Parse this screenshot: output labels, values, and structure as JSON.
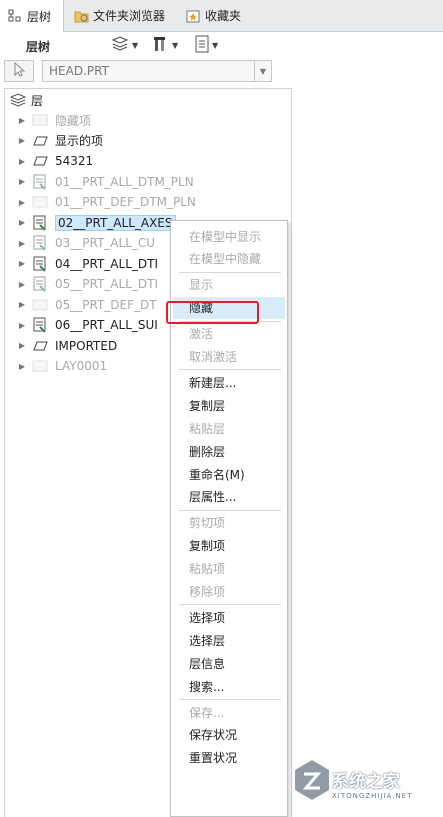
{
  "tabs": [
    {
      "label": "层树",
      "icon": "layer-tree-icon"
    },
    {
      "label": "文件夹浏览器",
      "icon": "folder-browser-icon"
    },
    {
      "label": "收藏夹",
      "icon": "favorites-icon"
    }
  ],
  "toolbar": {
    "label": "层树",
    "buttons": [
      {
        "icon": "layers-menu-icon"
      },
      {
        "icon": "tools-menu-icon"
      },
      {
        "icon": "settings-list-icon"
      }
    ]
  },
  "selector": {
    "model": "HEAD.PRT"
  },
  "tree": {
    "root_label": "层",
    "rows": [
      {
        "label": "隐藏项",
        "icon": "layer-gray-icon",
        "dim": true
      },
      {
        "label": "显示的项",
        "icon": "layer-flat-icon",
        "dim": false
      },
      {
        "label": "54321",
        "icon": "layer-flat-icon",
        "dim": false
      },
      {
        "label": "01__PRT_ALL_DTM_PLN",
        "icon": "layer-rule-icon",
        "dim": true
      },
      {
        "label": "01__PRT_DEF_DTM_PLN",
        "icon": "layer-gray-icon",
        "dim": true
      },
      {
        "label": "02__PRT_ALL_AXES",
        "icon": "layer-rule-icon",
        "dim": false,
        "selected": true
      },
      {
        "label": "03__PRT_ALL_CU",
        "icon": "layer-rule-icon",
        "dim": true
      },
      {
        "label": "04__PRT_ALL_DTI",
        "icon": "layer-rule-icon",
        "dim": false
      },
      {
        "label": "05__PRT_ALL_DTI",
        "icon": "layer-rule-icon",
        "dim": true
      },
      {
        "label": "05__PRT_DEF_DT",
        "icon": "layer-gray-icon",
        "dim": true
      },
      {
        "label": "06__PRT_ALL_SUI",
        "icon": "layer-rule-icon",
        "dim": false
      },
      {
        "label": "IMPORTED",
        "icon": "layer-flat-icon",
        "dim": false
      },
      {
        "label": "LAY0001",
        "icon": "layer-gray-icon",
        "dim": true
      }
    ]
  },
  "context_menu": {
    "items": [
      {
        "label": "在模型中显示",
        "enabled": false
      },
      {
        "label": "在模型中隐藏",
        "enabled": false
      },
      {
        "sep": true
      },
      {
        "label": "显示",
        "enabled": false
      },
      {
        "label": "隐藏",
        "enabled": true,
        "highlighted": true
      },
      {
        "sep": true
      },
      {
        "label": "激活",
        "enabled": false
      },
      {
        "label": "取消激活",
        "enabled": false
      },
      {
        "sep": true
      },
      {
        "label": "新建层...",
        "enabled": true
      },
      {
        "label": "复制层",
        "enabled": true
      },
      {
        "label": "粘贴层",
        "enabled": false
      },
      {
        "label": "删除层",
        "enabled": true
      },
      {
        "label": "重命名(M)",
        "enabled": true
      },
      {
        "label": "层属性...",
        "enabled": true
      },
      {
        "sep": true
      },
      {
        "label": "剪切项",
        "enabled": false
      },
      {
        "label": "复制项",
        "enabled": true
      },
      {
        "label": "粘贴项",
        "enabled": false
      },
      {
        "label": "移除项",
        "enabled": false
      },
      {
        "sep": true
      },
      {
        "label": "选择项",
        "enabled": true
      },
      {
        "label": "选择层",
        "enabled": true
      },
      {
        "label": "层信息",
        "enabled": true
      },
      {
        "label": "搜索...",
        "enabled": true
      },
      {
        "sep": true
      },
      {
        "label": "保存...",
        "enabled": false
      },
      {
        "label": "保存状况",
        "enabled": true
      },
      {
        "label": "重置状况",
        "enabled": true
      }
    ]
  },
  "watermark": {
    "text": "系统之家",
    "sub": "XITONGZHIJIA.NET"
  },
  "colors": {
    "highlight_bg": "#d9ecfa",
    "selection_bg": "#cde8ff",
    "annotation_red": "#e0212b",
    "disabled_text": "#a9a9a9"
  }
}
